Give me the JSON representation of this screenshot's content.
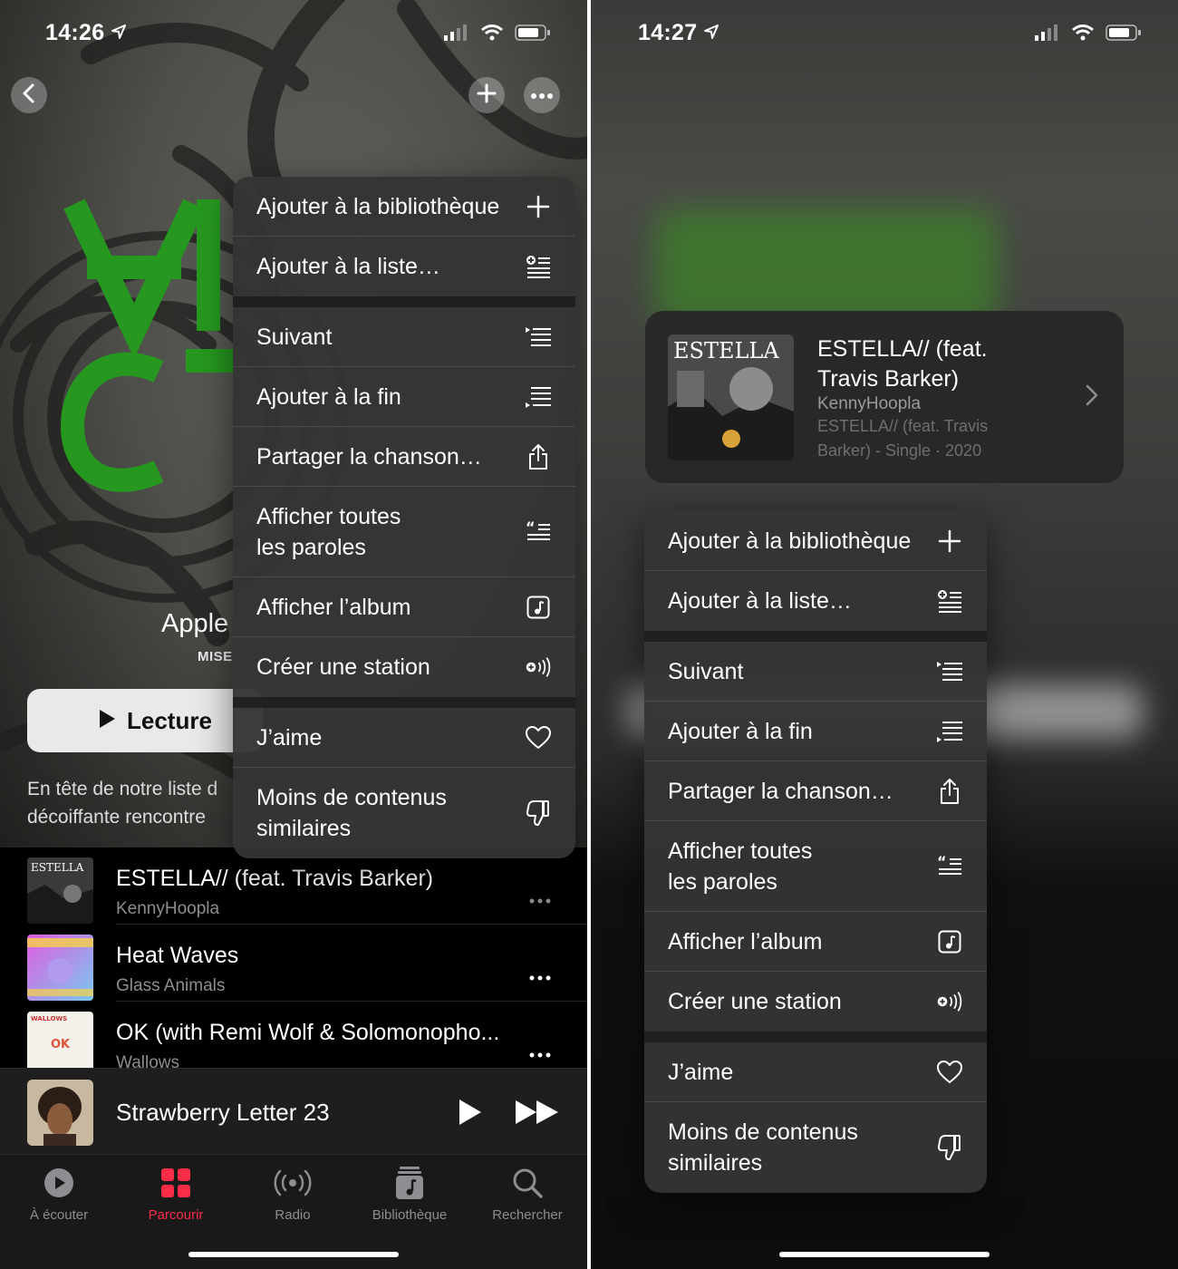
{
  "left": {
    "status": {
      "time": "14:26"
    },
    "hero": {
      "title_partial": "Apple",
      "subtitle_partial": "MISE",
      "play_label": "Lecture",
      "desc_line1": "En tête de notre liste d",
      "desc_line2": "décoiffante rencontre"
    },
    "menu": [
      {
        "label": "Ajouter à la bibliothèque",
        "icon": "plus-icon"
      },
      {
        "label": "Ajouter à la liste…",
        "icon": "add-to-playlist-icon"
      },
      {
        "label": "Suivant",
        "icon": "play-next-icon"
      },
      {
        "label": "Ajouter à la fin",
        "icon": "play-last-icon"
      },
      {
        "label": "Partager la chanson…",
        "icon": "share-icon"
      },
      {
        "label": "Afficher toutes\nles paroles",
        "icon": "lyrics-icon"
      },
      {
        "label": "Afficher l’album",
        "icon": "album-icon"
      },
      {
        "label": "Créer une station",
        "icon": "station-icon"
      },
      {
        "label": "J’aime",
        "icon": "heart-icon"
      },
      {
        "label": "Moins de contenus\nsimilaires",
        "icon": "thumbs-down-icon"
      }
    ],
    "tracks": [
      {
        "title": "ESTELLA// (feat. Travis Barker)",
        "artist": "KennyHoopla"
      },
      {
        "title": "Heat Waves",
        "artist": "Glass Animals"
      },
      {
        "title": "OK (with Remi Wolf & Solomonopho...",
        "artist": "Wallows"
      }
    ],
    "now_playing": {
      "title": "Strawberry Letter 23"
    },
    "tabs": [
      {
        "label": "À écouter",
        "icon": "listen-now-icon"
      },
      {
        "label": "Parcourir",
        "icon": "browse-icon"
      },
      {
        "label": "Radio",
        "icon": "radio-icon"
      },
      {
        "label": "Bibliothèque",
        "icon": "library-icon"
      },
      {
        "label": "Rechercher",
        "icon": "search-icon"
      }
    ],
    "art_labels": {
      "estella": "ESTELLA",
      "ok": "OK",
      "wallows": "WALLOWS"
    }
  },
  "right": {
    "status": {
      "time": "14:27"
    },
    "song": {
      "title": "ESTELLA// (feat. Travis Barker)",
      "artist": "KennyHoopla",
      "meta": "ESTELLA// (feat. Travis Barker) - Single · 2020"
    },
    "menu": [
      {
        "label": "Ajouter à la bibliothèque",
        "icon": "plus-icon"
      },
      {
        "label": "Ajouter à la liste…",
        "icon": "add-to-playlist-icon"
      },
      {
        "label": "Suivant",
        "icon": "play-next-icon"
      },
      {
        "label": "Ajouter à la fin",
        "icon": "play-last-icon"
      },
      {
        "label": "Partager la chanson…",
        "icon": "share-icon"
      },
      {
        "label": "Afficher toutes\nles paroles",
        "icon": "lyrics-icon"
      },
      {
        "label": "Afficher l’album",
        "icon": "album-icon"
      },
      {
        "label": "Créer une station",
        "icon": "station-icon"
      },
      {
        "label": "J’aime",
        "icon": "heart-icon"
      },
      {
        "label": "Moins de contenus\nsimilaires",
        "icon": "thumbs-down-icon"
      }
    ]
  },
  "colors": {
    "accent": "#fa2d48",
    "hero_green": "#35d32c",
    "menu_bg": "#343434"
  }
}
